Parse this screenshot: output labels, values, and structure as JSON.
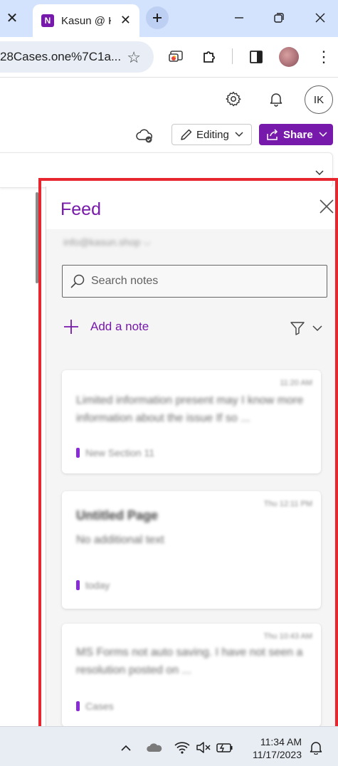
{
  "browser": {
    "tab_title": "Kasun @ K",
    "favicon_letter": "N",
    "url": "28Cases.one%7C1a...",
    "icons": [
      "close-icon",
      "onenote-icon",
      "plus-icon",
      "minimize-icon",
      "restore-icon",
      "close-icon",
      "star-icon",
      "cast-icon",
      "extensions-icon",
      "side-panel-icon",
      "profile-avatar",
      "more-icon"
    ]
  },
  "app_header": {
    "user_initials": "IK",
    "editing_label": "Editing",
    "share_label": "Share",
    "icons": [
      "settings-icon",
      "bell-icon",
      "cloud-sync-icon",
      "pencil-icon",
      "share-icon",
      "chevron-down-icon"
    ]
  },
  "feed": {
    "title": "Feed",
    "account": "info@kasun.shop",
    "search_placeholder": "Search notes",
    "add_note_label": "Add a note",
    "cards": [
      {
        "time": "11:20 AM",
        "title": "",
        "body": "Limited information present may I know more information about the issue If so ...",
        "section": "New Section 11"
      },
      {
        "time": "Thu 12:11 PM",
        "title": "Untitled Page",
        "body": "No additional text",
        "section": "today"
      },
      {
        "time": "Thu 10:43 AM",
        "title": "",
        "body": "MS Forms not auto saving. I have not seen a resolution posted on ...",
        "section": "Cases"
      }
    ]
  },
  "taskbar": {
    "time": "11:34 AM",
    "date": "11/17/2023",
    "icons": [
      "chevron-up-icon",
      "onedrive-icon",
      "wifi-icon",
      "volume-muted-icon",
      "battery-icon",
      "notification-bell-icon"
    ]
  },
  "colors": {
    "brand": "#7719aa",
    "highlight_frame": "#e8262f",
    "tab_strip": "#d3e3fd"
  }
}
